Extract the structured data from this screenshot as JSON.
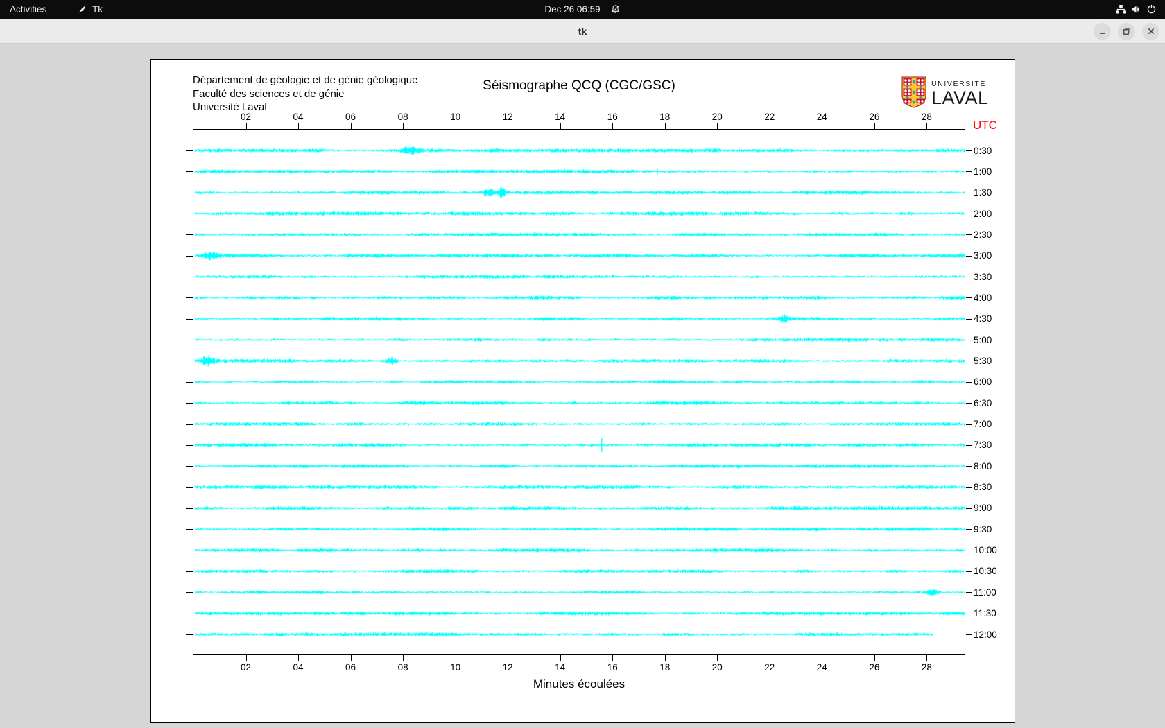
{
  "top_bar": {
    "activities_label": "Activities",
    "app_name": "Tk",
    "clock": "Dec 26  06:59",
    "icons": [
      "tk-feather-icon",
      "notifications-disabled-bell-icon",
      "network-icon",
      "volume-icon",
      "power-icon"
    ]
  },
  "window": {
    "title": "tk",
    "controls": [
      "minimize",
      "maximize",
      "close"
    ]
  },
  "seismograph": {
    "org_lines": [
      "Département de géologie et de génie géologique",
      "Faculté des sciences et de génie",
      "Université Laval"
    ],
    "title": "Séismographe QCQ (CGC/GSC)",
    "logo": {
      "line1": "UNIVERSITÉ",
      "line2": "LAVAL"
    },
    "utc_label": "UTC",
    "xlabel": "Minutes écoulées",
    "x_ticks": [
      "02",
      "04",
      "06",
      "08",
      "10",
      "12",
      "14",
      "16",
      "18",
      "20",
      "22",
      "24",
      "26",
      "28"
    ],
    "minutes_per_line": 29.5,
    "colors": {
      "trace": "#00ffff",
      "utc_text": "#ff0000",
      "axis": "#000000"
    },
    "rows": [
      {
        "label": "0:30",
        "events": [
          {
            "type": "burst",
            "x": 0.28,
            "w": 18,
            "amp": 3.2
          }
        ]
      },
      {
        "label": "1:00",
        "events": [
          {
            "type": "spike",
            "x": 0.6,
            "amp": 5
          }
        ]
      },
      {
        "label": "1:30",
        "events": [
          {
            "type": "burst",
            "x": 0.381,
            "w": 12,
            "amp": 4.2
          },
          {
            "type": "burst",
            "x": 0.398,
            "w": 9,
            "amp": 4.8
          }
        ]
      },
      {
        "label": "2:00",
        "events": []
      },
      {
        "label": "2:30",
        "events": []
      },
      {
        "label": "3:00",
        "events": [
          {
            "type": "burst",
            "x": 0.023,
            "w": 15,
            "amp": 3.2
          }
        ]
      },
      {
        "label": "3:30",
        "events": []
      },
      {
        "label": "4:00",
        "events": []
      },
      {
        "label": "4:30",
        "events": [
          {
            "type": "burst",
            "x": 0.764,
            "w": 11,
            "amp": 3.2
          }
        ]
      },
      {
        "label": "5:00",
        "events": []
      },
      {
        "label": "5:30",
        "events": [
          {
            "type": "burst",
            "x": 0.018,
            "w": 15,
            "amp": 4.6
          },
          {
            "type": "burst",
            "x": 0.256,
            "w": 11,
            "amp": 3.8
          }
        ]
      },
      {
        "label": "6:00",
        "events": []
      },
      {
        "label": "6:30",
        "events": []
      },
      {
        "label": "7:00",
        "events": []
      },
      {
        "label": "7:30",
        "events": [
          {
            "type": "spike",
            "x": 0.528,
            "amp": 10
          }
        ]
      },
      {
        "label": "8:00",
        "events": []
      },
      {
        "label": "8:30",
        "events": []
      },
      {
        "label": "9:00",
        "events": []
      },
      {
        "label": "9:30",
        "events": []
      },
      {
        "label": "10:00",
        "events": []
      },
      {
        "label": "10:30",
        "events": []
      },
      {
        "label": "11:00",
        "events": [
          {
            "type": "burst",
            "x": 0.956,
            "w": 9,
            "amp": 3.4
          }
        ]
      },
      {
        "label": "11:30",
        "events": []
      },
      {
        "label": "12:00",
        "events": [],
        "end": 0.958
      }
    ]
  }
}
